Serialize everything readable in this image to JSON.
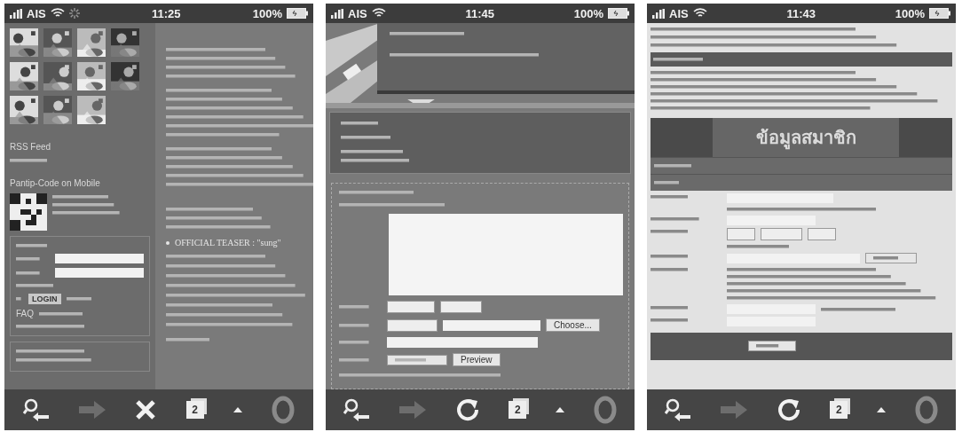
{
  "screens": [
    {
      "kind": "forum",
      "status_bar": {
        "carrier": "AIS",
        "time": "11:25",
        "battery": "100%",
        "loading": true
      },
      "rss_title": "RSS Feed",
      "mobile_title": "Pantip-Code on Mobile",
      "login_button": "LOGIN",
      "faq": "FAQ",
      "teaser": "OFFICIAL TEASER : \"sung\"",
      "toolbar": {
        "center_button": {
          "kind": "stop"
        },
        "forward_enabled": false,
        "tab_count": "2"
      }
    },
    {
      "kind": "editor",
      "status_bar": {
        "carrier": "AIS",
        "time": "11:45",
        "battery": "100%",
        "loading": false
      },
      "choose_button": "Choose...",
      "preview_button": "Preview",
      "toolbar": {
        "center_button": {
          "kind": "reload"
        },
        "forward_enabled": false,
        "tab_count": "2"
      }
    },
    {
      "kind": "register",
      "status_bar": {
        "carrier": "AIS",
        "time": "11:43",
        "battery": "100%",
        "loading": false
      },
      "section_title": "ข้อมูลสมาชิก",
      "toolbar": {
        "center_button": {
          "kind": "reload"
        },
        "forward_enabled": false,
        "tab_count": "2"
      }
    }
  ]
}
